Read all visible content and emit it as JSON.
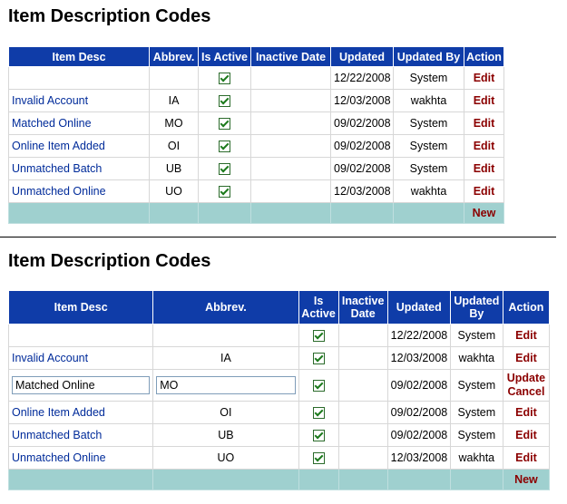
{
  "section1": {
    "title": "Item Description Codes",
    "columns": [
      "Item Desc",
      "Abbrev.",
      "Is Active",
      "Inactive Date",
      "Updated",
      "Updated By",
      "Action"
    ],
    "rows": [
      {
        "desc": "",
        "abbrev": "",
        "active": true,
        "inactive_date": "",
        "updated": "12/22/2008",
        "updated_by": "System",
        "action": "Edit"
      },
      {
        "desc": "Invalid Account",
        "abbrev": "IA",
        "active": true,
        "inactive_date": "",
        "updated": "12/03/2008",
        "updated_by": "wakhta",
        "action": "Edit"
      },
      {
        "desc": "Matched Online",
        "abbrev": "MO",
        "active": true,
        "inactive_date": "",
        "updated": "09/02/2008",
        "updated_by": "System",
        "action": "Edit"
      },
      {
        "desc": "Online Item Added",
        "abbrev": "OI",
        "active": true,
        "inactive_date": "",
        "updated": "09/02/2008",
        "updated_by": "System",
        "action": "Edit"
      },
      {
        "desc": "Unmatched Batch",
        "abbrev": "UB",
        "active": true,
        "inactive_date": "",
        "updated": "09/02/2008",
        "updated_by": "System",
        "action": "Edit"
      },
      {
        "desc": "Unmatched Online",
        "abbrev": "UO",
        "active": true,
        "inactive_date": "",
        "updated": "12/03/2008",
        "updated_by": "wakhta",
        "action": "Edit"
      }
    ],
    "footer_action": "New"
  },
  "section2": {
    "title": "Item Description Codes",
    "columns": [
      "Item Desc",
      "Abbrev.",
      "Is Active",
      "Inactive Date",
      "Updated",
      "Updated By",
      "Action"
    ],
    "rows": [
      {
        "desc": "",
        "abbrev": "",
        "active": true,
        "inactive_date": "",
        "updated": "12/22/2008",
        "updated_by": "System",
        "action": "Edit"
      },
      {
        "desc": "Invalid Account",
        "abbrev": "IA",
        "active": true,
        "inactive_date": "",
        "updated": "12/03/2008",
        "updated_by": "wakhta",
        "action": "Edit"
      },
      {
        "desc": "Matched Online",
        "abbrev": "MO",
        "active": true,
        "inactive_date": "",
        "updated": "09/02/2008",
        "updated_by": "System",
        "update_label": "Update",
        "cancel_label": "Cancel",
        "editing": true
      },
      {
        "desc": "Online Item Added",
        "abbrev": "OI",
        "active": true,
        "inactive_date": "",
        "updated": "09/02/2008",
        "updated_by": "System",
        "action": "Edit"
      },
      {
        "desc": "Unmatched Batch",
        "abbrev": "UB",
        "active": true,
        "inactive_date": "",
        "updated": "09/02/2008",
        "updated_by": "System",
        "action": "Edit"
      },
      {
        "desc": "Unmatched Online",
        "abbrev": "UO",
        "active": true,
        "inactive_date": "",
        "updated": "12/03/2008",
        "updated_by": "wakhta",
        "action": "Edit"
      }
    ],
    "footer_action": "New"
  },
  "colors": {
    "header_bg": "#0f3ca8",
    "footer_bg": "#9fd0cf",
    "action_link": "#8b0000",
    "desc_text": "#002b9a"
  },
  "icons": {
    "active_checkbox": "checkbox-checked-icon"
  }
}
